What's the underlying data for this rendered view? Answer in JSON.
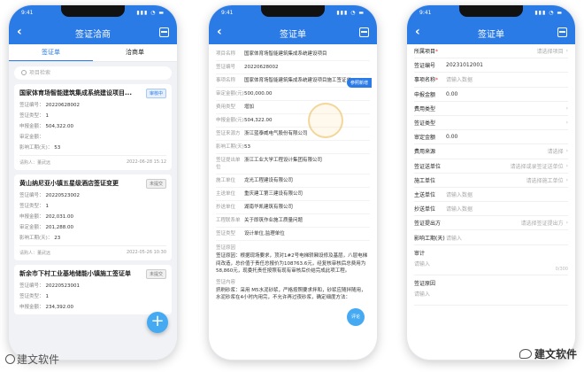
{
  "status": {
    "time": "9:41",
    "signal": "▮▮▮ ◔ ▬"
  },
  "phone1": {
    "title": "签证洽商",
    "tabs": [
      "签证单",
      "洽商单"
    ],
    "search_placeholder": "项目检索",
    "fab": "+",
    "cards": [
      {
        "title": "国家体育场智能建筑集成系统建设项目...",
        "badge": "审核中",
        "badge_type": "blue",
        "no_label": "签证编号：",
        "no": "20220628002",
        "type_label": "签证类型：",
        "type": "1",
        "amount_label": "申报金额：",
        "amount": "504,322.00",
        "audit_label": "审定金额：",
        "audit": "",
        "days_label": "影响工期(天)：",
        "days": "53",
        "applicant_label": "请购人：",
        "applicant": "董武远",
        "time": "2022-06-28 15:12"
      },
      {
        "title": "黄山纳尼亚小镇五星级酒店签证变更",
        "badge": "未提交",
        "badge_type": "gray",
        "no_label": "签证编号：",
        "no": "20220523002",
        "type_label": "签证类型：",
        "type": "1",
        "amount_label": "申报金额：",
        "amount": "202,031.00",
        "audit_label": "审定金额：",
        "audit": "201,288.00",
        "days_label": "影响工期(天)：",
        "days": "23",
        "applicant_label": "请购人：",
        "applicant": "董武远",
        "time": "2022-05-26 10:30"
      },
      {
        "title": "新余市下村工业基地储能小镇施工签证单",
        "badge": "未提交",
        "badge_type": "gray",
        "no_label": "签证编号：",
        "no": "20220523001",
        "type_label": "签证类型：",
        "type": "1",
        "amount_label": "申报金额：",
        "amount": "234,392.00"
      }
    ]
  },
  "phone2": {
    "title": "签证单",
    "ref_button": "参照新增",
    "comment_button": "评论",
    "rows": [
      {
        "label": "项目名称",
        "value": "国家体育场智能建筑集成系统建设项目"
      },
      {
        "label": "签证编号",
        "value": "20220628002"
      },
      {
        "label": "事项名称",
        "value": "国家体育场智能建筑集成系统建设项目施工签证单"
      },
      {
        "label": "审定金额(元)",
        "value": "500,000.00"
      },
      {
        "label": "费用类型",
        "value": "增加"
      },
      {
        "label": "申报金额(元)",
        "value": "504,322.00"
      },
      {
        "label": "签证来源方",
        "value": "浙江蓝泰威电气股份有限公司"
      },
      {
        "label": "影响工期(天)",
        "value": "53"
      },
      {
        "label": "签证提出单位",
        "value": "浙江工业大学工程设计集团有限公司"
      },
      {
        "label": "施工单位",
        "value": "龙光工程建设有限公司"
      },
      {
        "label": "主送单位",
        "value": "重庆建工第三建设有限公司"
      },
      {
        "label": "抄送单位",
        "value": "湖南华凯建筑有限公司"
      },
      {
        "label": "工程联系单",
        "value": "关于即筑作业施工质量问题"
      },
      {
        "label": "签证类型",
        "value": "设计单位,监理单位"
      }
    ],
    "reason_label": "签证原因",
    "reason_text": "签证原因：根据现场要求，顶对1#2号电梯轿厢设修及基层，八层电梯间改造，总价值于责任总报价为108763.6元，经复核审核后总费用为58,860元，现委托责任按照有现有审核后价结完成此项工程。",
    "content_label": "签证内容",
    "content_text": "挤刷砂浆：采用 M5水泥砂浆，严格按照要求拌和，砂浆应随拌随用，水泥砂浆在4小时内用完，不允许再过夜砂浆，确定细度方法："
  },
  "phone3": {
    "title": "签证单",
    "rows": [
      {
        "label": "所属项目",
        "req": true,
        "value": "请选择项目",
        "arrow": true,
        "align": "right"
      },
      {
        "label": "签证编号",
        "req": false,
        "value": "20231012001",
        "arrow": false,
        "align": "left"
      },
      {
        "label": "事项名称",
        "req": true,
        "value": "请输入数据",
        "arrow": false,
        "align": "left"
      },
      {
        "label": "申报金额",
        "req": false,
        "value": "0.00",
        "arrow": false,
        "align": "left"
      },
      {
        "label": "费用类型",
        "req": false,
        "value": "",
        "arrow": true,
        "align": "right"
      },
      {
        "label": "签证类型",
        "req": false,
        "value": "",
        "arrow": true,
        "align": "right"
      },
      {
        "label": "审定金额",
        "req": false,
        "value": "0.00",
        "arrow": false,
        "align": "left"
      },
      {
        "label": "费用来源",
        "req": false,
        "value": "请选择",
        "arrow": true,
        "align": "right"
      },
      {
        "label": "签证送单位",
        "req": false,
        "value": "请选择或录签证送单位",
        "arrow": true,
        "align": "right"
      },
      {
        "label": "施工单位",
        "req": false,
        "value": "请选择施工单位",
        "arrow": true,
        "align": "right"
      },
      {
        "label": "主送单位",
        "req": false,
        "value": "请输入数据",
        "arrow": false,
        "align": "left"
      },
      {
        "label": "抄送单位",
        "req": false,
        "value": "请输入数据",
        "arrow": false,
        "align": "left"
      },
      {
        "label": "签证提出方",
        "req": false,
        "value": "请选择签证提出方",
        "arrow": true,
        "align": "right"
      },
      {
        "label": "影响工期(天)",
        "req": false,
        "value": "请输入",
        "arrow": false,
        "align": "left"
      }
    ],
    "audit_label": "审计",
    "audit_placeholder": "请输入",
    "counter": "0/300",
    "reason_label": "签证原因",
    "reason_placeholder": "请输入"
  },
  "watermark_left": "建文软件",
  "watermark_right": "建文软件"
}
